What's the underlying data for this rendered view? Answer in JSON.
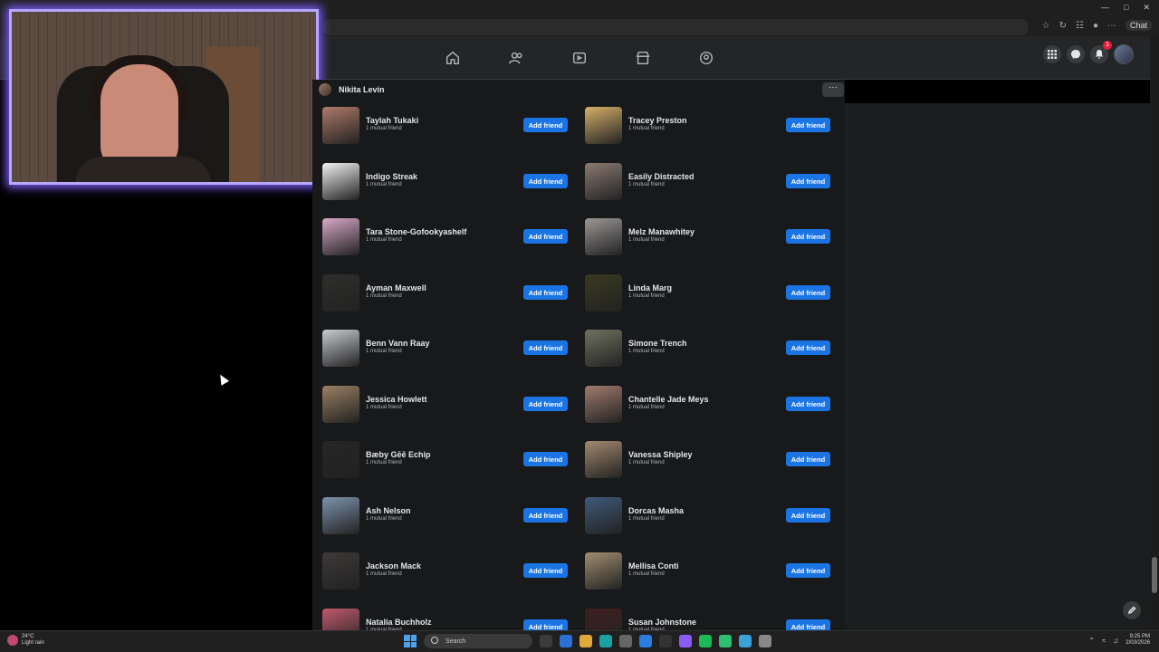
{
  "profile": {
    "name": "Nikita Levin"
  },
  "chat_label": "Chat",
  "notification_count": "1",
  "more_label": "···",
  "add_label": "Add friend",
  "mutual": "1 mutual friend",
  "left_column": [
    {
      "name": "Taylah Tukaki",
      "color": "#b07a6a"
    },
    {
      "name": "Indigo Streak",
      "color": "#f2f2f2"
    },
    {
      "name": "Tara Stone-Gofookyashelf",
      "color": "#d8a9c8"
    },
    {
      "name": "Ayman Maxwell",
      "color": "#2e2f2b"
    },
    {
      "name": "Benn Vann Raay",
      "color": "#c9ccd1"
    },
    {
      "name": "Jessica Howlett",
      "color": "#9b8064"
    },
    {
      "name": "Bæby Gēē Echip",
      "color": "#262626"
    },
    {
      "name": "Ash Nelson",
      "color": "#7e93ad"
    },
    {
      "name": "Jackson Mack",
      "color": "#3d3a38"
    },
    {
      "name": "Natalia Buchholz",
      "color": "#c05a6e"
    }
  ],
  "right_column": [
    {
      "name": "Tracey Preston",
      "color": "#d6b06a"
    },
    {
      "name": "Easily Distracted",
      "color": "#8b7b72"
    },
    {
      "name": "Melz Manawhitey",
      "color": "#9c9896"
    },
    {
      "name": "Linda Marg",
      "color": "#3a3a20"
    },
    {
      "name": "Simone Trench",
      "color": "#6f7360"
    },
    {
      "name": "Chantelle Jade Meys",
      "color": "#a27b6e"
    },
    {
      "name": "Vanessa Shipley",
      "color": "#a58a70"
    },
    {
      "name": "Dorcas Masha",
      "color": "#3f5a7a"
    },
    {
      "name": "Mellisa Conti",
      "color": "#a18d70"
    },
    {
      "name": "Susan Johnstone",
      "color": "#402020"
    }
  ],
  "taskbar": {
    "weather_temp": "24°C",
    "weather_desc": "Light rain",
    "search_label": "Search",
    "time": "9:25 PM",
    "date": "2/03/2026"
  }
}
